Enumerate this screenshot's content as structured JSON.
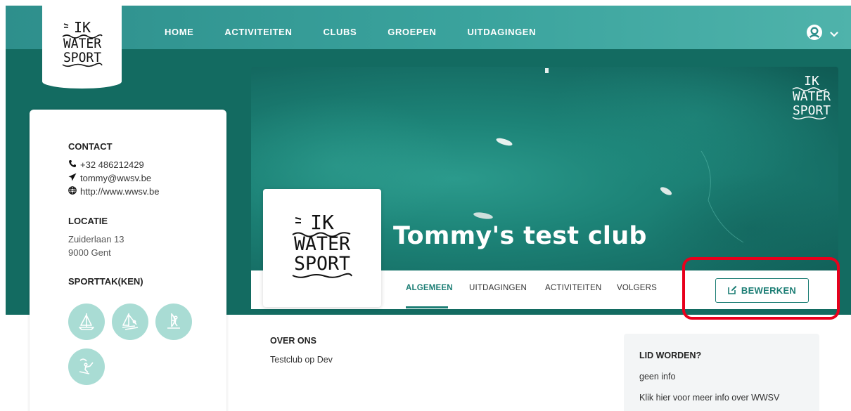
{
  "nav": {
    "items": [
      {
        "label": "HOME"
      },
      {
        "label": "ACTIVITEITEN"
      },
      {
        "label": "CLUBS"
      },
      {
        "label": "GROEPEN"
      },
      {
        "label": "UITDAGINGEN"
      }
    ],
    "user_icon": "user-circle-icon",
    "chevron_icon": "chevron-down-icon"
  },
  "brand": {
    "logo_lines": [
      "IK",
      "WATER",
      "SPORT"
    ]
  },
  "club": {
    "name": "Tommy's test club"
  },
  "sidebar": {
    "contact_title": "CONTACT",
    "phone": "+32 486212429",
    "email": "tommy@wwsv.be",
    "website": "http://www.wwsv.be",
    "location_title": "LOCATIE",
    "address_line1": "Zuiderlaan 13",
    "address_line2": "9000 Gent",
    "sports_title": "SPORTTAK(KEN)",
    "sports": [
      {
        "icon": "sailboat-icon"
      },
      {
        "icon": "catamaran-icon"
      },
      {
        "icon": "windsurf-icon"
      },
      {
        "icon": "kitesurf-icon"
      }
    ]
  },
  "tabs": [
    {
      "label": "ALGEMEEN",
      "active": true
    },
    {
      "label": "UITDAGINGEN",
      "active": false
    },
    {
      "label": "ACTIVITEITEN",
      "active": false
    },
    {
      "label": "VOLGERS",
      "active": false
    }
  ],
  "edit_button": {
    "label": "BEWERKEN",
    "icon": "edit-icon"
  },
  "about": {
    "title": "OVER ONS",
    "text": "Testclub op Dev"
  },
  "join": {
    "title": "LID WORDEN?",
    "info": "geen info",
    "link": "Klik hier voor meer info over WWSV"
  },
  "colors": {
    "teal_dark": "#136b61",
    "teal_nav": "#3aa39d",
    "accent": "#1b7d74",
    "sport_icon_bg": "#a9dcd4",
    "highlight": "#e8001c"
  }
}
